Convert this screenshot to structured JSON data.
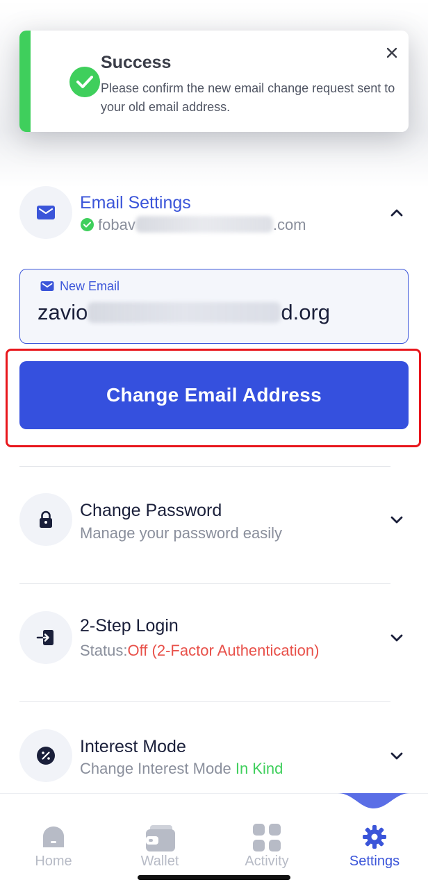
{
  "toast": {
    "title": "Success",
    "message": "Please confirm the new email change request sent to your old email address.",
    "accent_color": "#3fcf5c",
    "icon": "check-circle-icon",
    "close_icon": "close-icon"
  },
  "email_settings": {
    "title": "Email Settings",
    "current_email_prefix": "fobav",
    "current_email_suffix": ".com",
    "icon": "mail-icon",
    "expanded": true,
    "new_email": {
      "label": "New Email",
      "value_prefix": "zavio",
      "value_suffix": "d.org"
    },
    "change_button_label": "Change Email Address"
  },
  "change_password": {
    "title": "Change Password",
    "subtitle": "Manage your password easily",
    "icon": "lock-icon"
  },
  "two_step": {
    "title": "2-Step Login",
    "status_label": "Status:",
    "status_value": "Off (2-Factor Authentication)",
    "icon": "login-icon"
  },
  "interest_mode": {
    "title": "Interest Mode",
    "subtitle": "Change Interest Mode",
    "mode_value": "In Kind",
    "icon": "percent-icon"
  },
  "nav": {
    "items": [
      {
        "label": "Home",
        "icon": "home-icon"
      },
      {
        "label": "Wallet",
        "icon": "wallet-icon"
      },
      {
        "label": "Activity",
        "icon": "grid-icon"
      },
      {
        "label": "Settings",
        "icon": "gear-icon",
        "active": true
      }
    ]
  },
  "colors": {
    "primary": "#3550de",
    "link": "#3b55d9",
    "success": "#3fcf5c",
    "danger": "#e8514a",
    "highlight": "#e8161c"
  }
}
